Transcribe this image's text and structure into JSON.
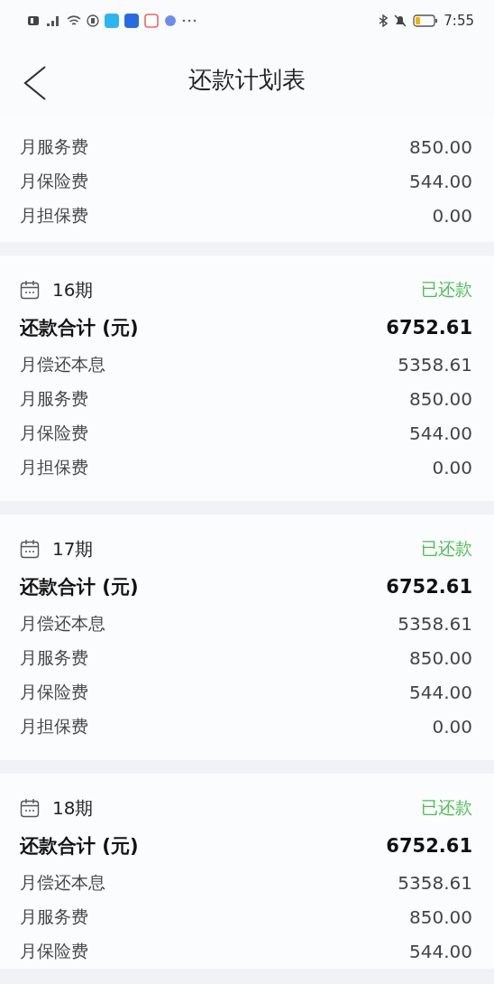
{
  "status_bar": {
    "time": "7:55"
  },
  "header": {
    "title": "还款计划表"
  },
  "partial_card": {
    "items": [
      {
        "label": "月服务费",
        "value": "850.00"
      },
      {
        "label": "月保险费",
        "value": "544.00"
      },
      {
        "label": "月担保费",
        "value": "0.00"
      }
    ]
  },
  "periods": [
    {
      "period": "16期",
      "status": "已还款",
      "total_label": "还款合计 (元)",
      "total": "6752.61",
      "items": [
        {
          "label": "月偿还本息",
          "value": "5358.61"
        },
        {
          "label": "月服务费",
          "value": "850.00"
        },
        {
          "label": "月保险费",
          "value": "544.00"
        },
        {
          "label": "月担保费",
          "value": "0.00"
        }
      ]
    },
    {
      "period": "17期",
      "status": "已还款",
      "total_label": "还款合计 (元)",
      "total": "6752.61",
      "items": [
        {
          "label": "月偿还本息",
          "value": "5358.61"
        },
        {
          "label": "月服务费",
          "value": "850.00"
        },
        {
          "label": "月保险费",
          "value": "544.00"
        },
        {
          "label": "月担保费",
          "value": "0.00"
        }
      ]
    },
    {
      "period": "18期",
      "status": "已还款",
      "total_label": "还款合计 (元)",
      "total": "6752.61",
      "items": [
        {
          "label": "月偿还本息",
          "value": "5358.61"
        },
        {
          "label": "月服务费",
          "value": "850.00"
        },
        {
          "label": "月保险费",
          "value": "544.00"
        }
      ]
    }
  ]
}
